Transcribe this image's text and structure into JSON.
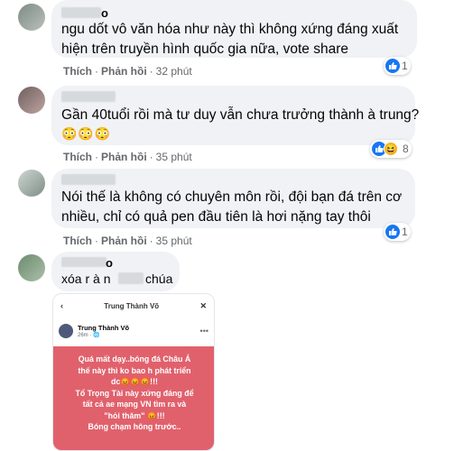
{
  "colors": {
    "bubble": "#f0f2f5",
    "meta": "#65676b",
    "like": "#1877f2",
    "card_bg": "#e0616c"
  },
  "comments": [
    {
      "name_tail": "o",
      "lines": [
        "ngu dốt vô văn hóa như này thì không xứng đáng xuất",
        "hiện trên truyền hình quốc gia nữa, vote share"
      ],
      "like_label": "Thích",
      "reply_label": "Phản hồi",
      "time": "32 phút",
      "reaction_count": "1",
      "reactions": [
        "like-icon"
      ]
    },
    {
      "lines": [
        "Gần 40tuổi rồi mà tư duy vẫn chưa trưởng thành à trung?"
      ],
      "emojis": "😳😳😳",
      "like_label": "Thích",
      "reply_label": "Phản hồi",
      "time": "35 phút",
      "reaction_count": "8",
      "reactions": [
        "like-icon",
        "haha-icon"
      ]
    },
    {
      "lines": [
        "Nói thế là không có chuyên môn rồi, đội bạn đá trên cơ",
        "nhiều, chỉ có quả pen đầu tiên là hơi nặng tay thôi"
      ],
      "like_label": "Thích",
      "reply_label": "Phản hồi",
      "time": "35 phút",
      "reaction_count": "1",
      "reactions": [
        "like-icon"
      ]
    },
    {
      "name_tail": "o",
      "lines_left": "xóa r à n",
      "lines_right": "chúa"
    }
  ],
  "image": {
    "header_title": "Trung Thành Võ",
    "author": "Trung Thành Võ",
    "time": "26m · 🌐",
    "post_lines": [
      "Quá mất dạy..bóng đá Châu Á",
      "thế này thì ko bao h phát triển",
      "dc😡😡😡!!!",
      "Tổ Trọng Tài này xứng đáng để",
      "tất cả ae mạng VN tìm ra và",
      "\"hỏi thăm\" 😡!!!",
      "Bóng chạm hông trước.."
    ]
  }
}
